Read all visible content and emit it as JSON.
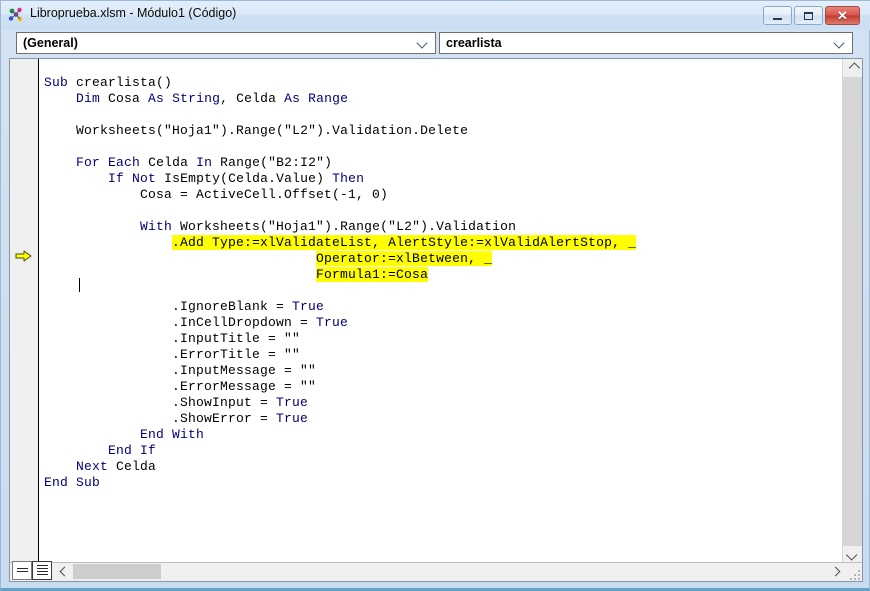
{
  "window": {
    "title": "Libroprueba.xlsm - Módulo1 (Código)",
    "app_icon": "vba-module-icon",
    "controls": {
      "minimize_label": "—",
      "restore_label": "❐",
      "close_label": "✕"
    }
  },
  "toolbar": {
    "object_combo": {
      "value": "(General)",
      "placeholder": "(General)"
    },
    "procedure_combo": {
      "value": "crearlista",
      "placeholder": "crearlista"
    }
  },
  "editor": {
    "margin_indicator": "bookmark-arrow",
    "code_lines": [
      "Sub crearlista()",
      "    Dim Cosa As String, Celda As Range",
      "",
      "    Worksheets(\"Hoja1\").Range(\"L2\").Validation.Delete",
      "",
      "    For Each Celda In Range(\"B2:I2\")",
      "        If Not IsEmpty(Celda.Value) Then",
      "            Cosa = ActiveCell.Offset(-1, 0)",
      "",
      "            With Worksheets(\"Hoja1\").Range(\"L2\").Validation",
      "                .Add Type:=xlValidateList, AlertStyle:=xlValidAlertStop, _",
      "                                  Operator:=xlBetween, _",
      "                                  Formula1:=Cosa",
      "",
      "                .IgnoreBlank = True",
      "                .InCellDropdown = True",
      "                .InputTitle = \"\"",
      "                .ErrorTitle = \"\"",
      "                .InputMessage = \"\"",
      "                .ErrorMessage = \"\"",
      "                .ShowInput = True",
      "                .ShowError = True",
      "            End With",
      "        End If",
      "    Next Celda",
      "End Sub"
    ],
    "selected_text": [
      ".Add Type:=xlValidateList, AlertStyle:=xlValidAlertStop, _",
      "Operator:=xlBetween, _",
      "Formula1:=Cosa"
    ],
    "keywords": [
      "Sub",
      "Dim",
      "As",
      "For",
      "Each",
      "In",
      "If",
      "Not",
      "Then",
      "With",
      "True",
      "End",
      "Next"
    ],
    "colors": {
      "keyword": "#00007f",
      "identifier": "#000000",
      "selection_background": "#ffff00",
      "editor_background": "#ffffff"
    }
  },
  "statusbar": {
    "procedure_view_label": "Procedure View",
    "full_module_view_label": "Full Module View"
  },
  "scrollbars": {
    "vertical_up": "chevron-up",
    "vertical_down": "chevron-down",
    "horizontal_left": "chevron-left",
    "horizontal_right": "chevron-right"
  }
}
